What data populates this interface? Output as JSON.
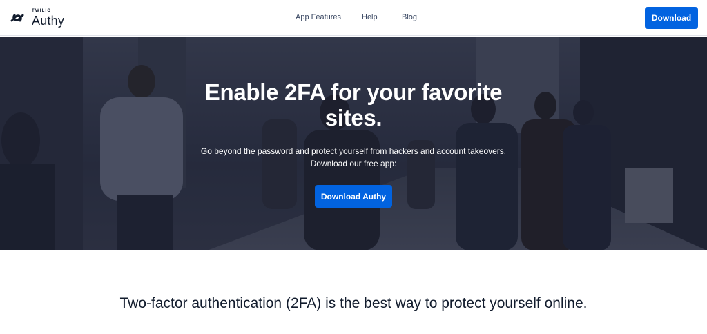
{
  "header": {
    "brand_small": "TWILIO",
    "brand_name": "Authy",
    "nav": {
      "features": "App Features",
      "help": "Help",
      "blog": "Blog"
    },
    "download_label": "Download"
  },
  "hero": {
    "title": "Enable 2FA for your favorite sites.",
    "subtitle_line1": "Go beyond the password and protect yourself from hackers and account takeovers.",
    "subtitle_line2": "Download our free app:",
    "cta_label": "Download Authy"
  },
  "section": {
    "heading": "Two-factor authentication (2FA) is the best way to protect yourself online."
  },
  "colors": {
    "accent": "#0263e0",
    "text": "#121c2d"
  }
}
